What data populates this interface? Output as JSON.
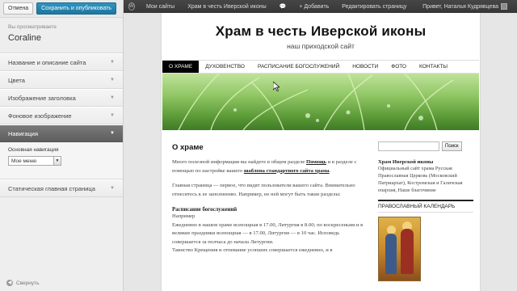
{
  "customizer": {
    "cancel_label": "Отмена",
    "save_label": "Сохранить и опубликовать",
    "viewing_label": "Вы просматриваете",
    "theme_name": "Coraline",
    "sections": [
      {
        "label": "Название и описание сайта"
      },
      {
        "label": "Цвета"
      },
      {
        "label": "Изображение заголовка"
      },
      {
        "label": "Фоновое изображение"
      },
      {
        "label": "Навигация"
      },
      {
        "label": "Статическая главная страница"
      }
    ],
    "nav_body": {
      "label": "Основная навигация",
      "select_value": "Мое меню"
    },
    "collapse_label": "Свернуть"
  },
  "adminbar": {
    "items": [
      "Мои сайты",
      "Храм в честь Иверской иконы",
      "",
      "+ Добавить",
      "Редактировать страницу"
    ],
    "greeting": "Привет, Наталья Кудрявцева"
  },
  "site": {
    "title": "Храм в честь Иверской иконы",
    "description": "наш приходской сайт",
    "nav": [
      "О ХРАМЕ",
      "ДУХОВЕНСТВО",
      "РАСПИСАНИЕ БОГОСЛУЖЕНИЙ",
      "НОВОСТИ",
      "ФОТО",
      "КОНТАКТЫ"
    ],
    "active_nav": 0
  },
  "entry": {
    "title": "О храме",
    "p1_a": "Много полезной информации вы найдете в общем разделе ",
    "p1_link1": "Помощь",
    "p1_b": " и в разделе с помощью по настройке вашего ",
    "p1_link2": "шаблона стандартного сайта храма",
    "p1_c": ".",
    "p2": "Главная страница — первое, что видят пользователи вашего сайта. Внимательно отнеситесь к ее заполнению. Например, не ней могут быть такие разделы:",
    "subhead": "Расписание богослужений",
    "line1": "Например",
    "line2": "Ежедневно в нашем храме всенощная в 17.00, Литургия в 8.00; по воскресеньям и в великие праздники всенощная — в 17.00, Литургия — в 10 час. Исповедь совершается за полчаса до начала Литургии.",
    "line3": "Таинство Крещения и отпевание усопших совершается ежедневно, и в"
  },
  "sidebar": {
    "search_button": "Поиск",
    "church_title": "Храм Иверской иконы",
    "church_text": "Официальный сайт храма Русская Православная Церковь (Московский Патриархат), Костромская и Галичская епархия, Наше благочиние",
    "calendar_title": "ПРАВОСЛАВНЫЙ КАЛЕНДАРЬ"
  },
  "colors": {
    "save_button": "#21759b",
    "adminbar": "#373737",
    "nav_active": "#000000",
    "open_section": "#5e5e5e"
  }
}
